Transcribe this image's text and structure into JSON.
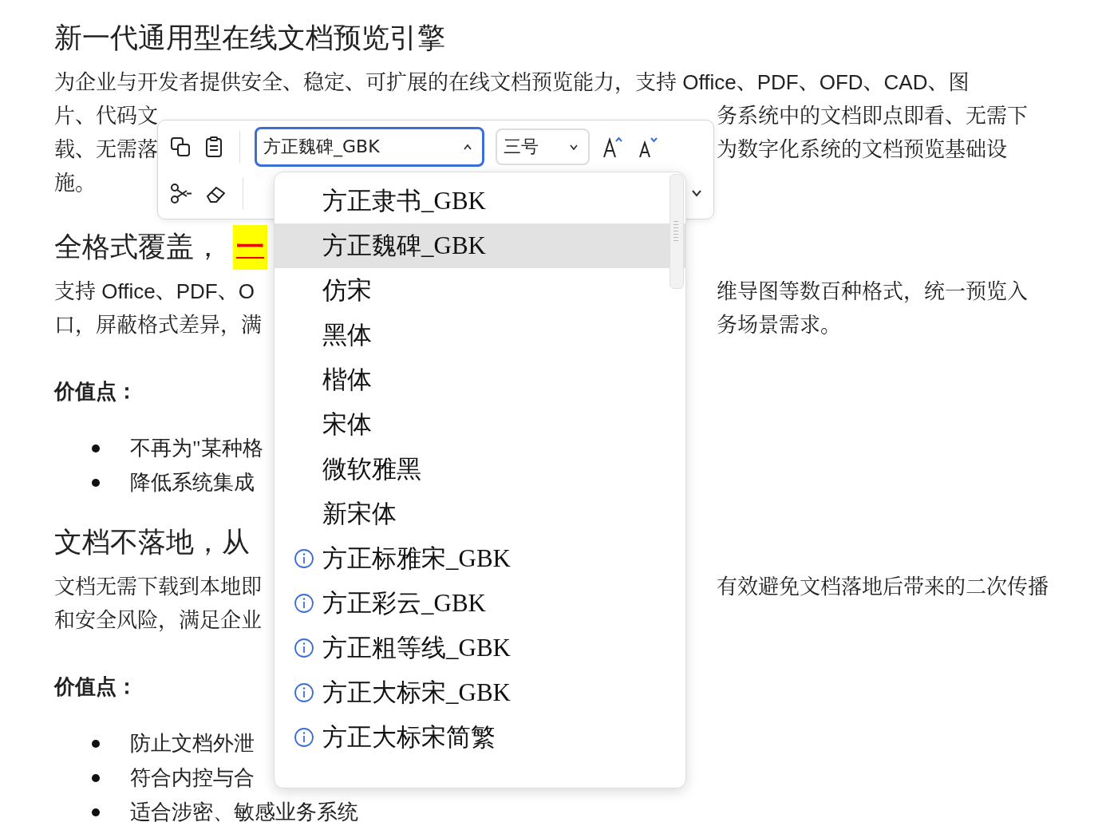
{
  "document": {
    "blocks": [
      {
        "kind": "heading",
        "lines": [
          {
            "left": "新一代通用型在线文档预览引擎"
          }
        ]
      },
      {
        "kind": "paragraph",
        "lines": [
          {
            "left": "为企业与开发者提供安全、稳定、可扩展的在线文档预览能力，支持 Office、PDF、OFD、CAD、图"
          },
          {
            "left": "片、代码文",
            "right": "务系统中的文档即点即看、无需下"
          },
          {
            "left": "载、无需落",
            "right": "为数字化系统的文档预览基础设"
          },
          {
            "left": "施。"
          }
        ]
      },
      {
        "kind": "heading",
        "lines": [
          {
            "left": "全格式覆盖，",
            "highlight": "一"
          }
        ]
      },
      {
        "kind": "paragraph",
        "lines": [
          {
            "left": "支持 Office、PDF、O",
            "right": "维导图等数百种格式，统一预览入"
          },
          {
            "left": "口，屏蔽格式差异，满",
            "right": "务场景需求。"
          }
        ]
      },
      {
        "kind": "label",
        "lines": [
          {
            "left": "价值点："
          }
        ]
      },
      {
        "kind": "bullets",
        "lines": [
          {
            "left": "不再为\"某种格"
          },
          {
            "left": "降低系统集成"
          }
        ]
      },
      {
        "kind": "heading",
        "lines": [
          {
            "left": "文档不落地，从"
          }
        ]
      },
      {
        "kind": "paragraph",
        "lines": [
          {
            "left": "文档无需下载到本地即",
            "right": "有效避免文档落地后带来的二次传播"
          },
          {
            "left": "和安全风险，满足企业"
          }
        ]
      },
      {
        "kind": "label",
        "lines": [
          {
            "left": "价值点："
          }
        ]
      },
      {
        "kind": "bullets",
        "lines": [
          {
            "left": "防止文档外泄"
          },
          {
            "left": "符合内控与合"
          },
          {
            "left": "适合涉密、敏感业务系统"
          }
        ]
      }
    ]
  },
  "toolbar": {
    "font_select": {
      "value": "方正魏碑_GBK",
      "expanded": true
    },
    "size_select": {
      "value": "三号"
    }
  },
  "font_menu": {
    "items": [
      {
        "label": "方正隶书_GBK",
        "selected": false,
        "info": false
      },
      {
        "label": "方正魏碑_GBK",
        "selected": true,
        "info": false
      },
      {
        "label": "仿宋",
        "selected": false,
        "info": false
      },
      {
        "label": "黑体",
        "selected": false,
        "info": false
      },
      {
        "label": "楷体",
        "selected": false,
        "info": false
      },
      {
        "label": "宋体",
        "selected": false,
        "info": false
      },
      {
        "label": "微软雅黑",
        "selected": false,
        "info": false
      },
      {
        "label": "新宋体",
        "selected": false,
        "info": false
      },
      {
        "label": "方正标雅宋_GBK",
        "selected": false,
        "info": true
      },
      {
        "label": "方正彩云_GBK",
        "selected": false,
        "info": true
      },
      {
        "label": "方正粗等线_GBK",
        "selected": false,
        "info": true
      },
      {
        "label": "方正大标宋_GBK",
        "selected": false,
        "info": true
      },
      {
        "label": "方正大标宋简繁",
        "selected": false,
        "info": true
      }
    ]
  }
}
